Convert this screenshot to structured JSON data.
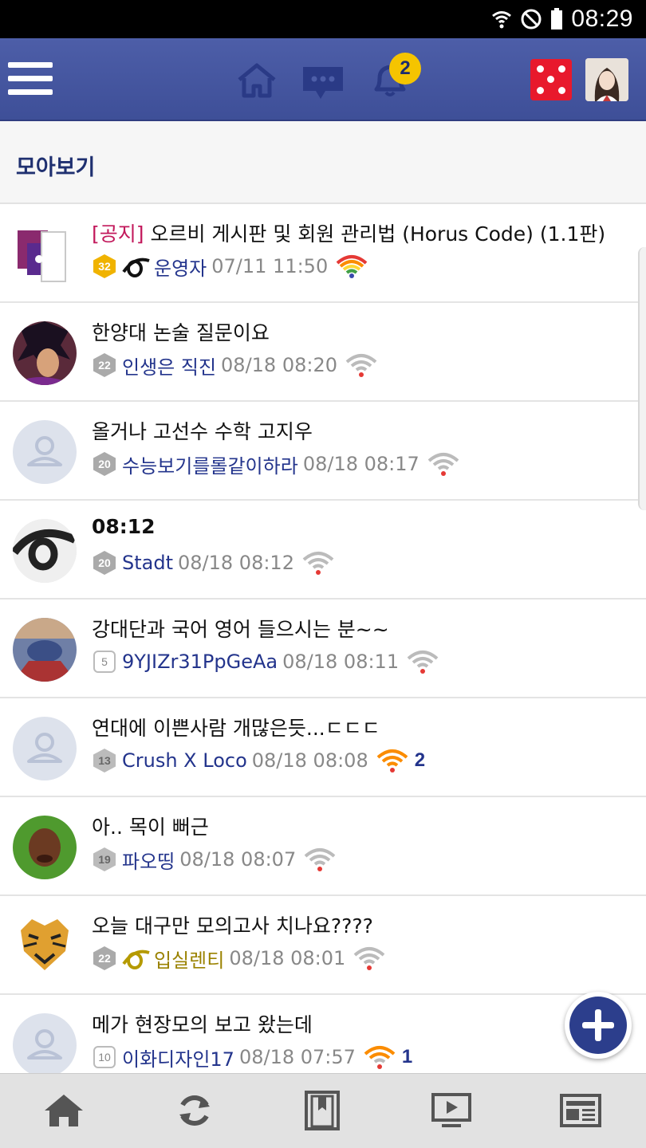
{
  "status_bar": {
    "time": "08:29"
  },
  "top_bar": {
    "icons": [
      "menu-icon",
      "home-icon",
      "chat-icon",
      "bell-icon",
      "dice-icon",
      "profile-avatar"
    ],
    "notification_badge": "2",
    "accent": "#4d5ea8"
  },
  "section": {
    "title": "모아보기"
  },
  "posts": [
    {
      "tag": "[공지]",
      "title": "오르비 게시판 및 회원 관리법 (Horus Code) (1.1판)",
      "level": "32",
      "author": "운영자",
      "time": "07/11 11:50",
      "count": ""
    },
    {
      "tag": "",
      "title": "한양대 논술 질문이요",
      "level": "22",
      "author": "인생은 직진",
      "time": "08/18 08:20",
      "count": ""
    },
    {
      "tag": "",
      "title": "올거나 고선수 수학 고지우",
      "level": "20",
      "author": "수능보기를롤같이하라",
      "time": "08/18 08:17",
      "count": ""
    },
    {
      "tag": "",
      "title": "08:12",
      "level": "20",
      "author": "Stadt",
      "time": "08/18 08:12",
      "count": ""
    },
    {
      "tag": "",
      "title": "강대단과 국어 영어 들으시는 분~~",
      "level": "5",
      "author": "9YJIZr31PpGeAa",
      "time": "08/18 08:11",
      "count": ""
    },
    {
      "tag": "",
      "title": "연대에 이쁜사람 개많은듯...ㄷㄷㄷ",
      "level": "13",
      "author": "Crush X Loco",
      "time": "08/18 08:08",
      "count": "2"
    },
    {
      "tag": "",
      "title": "아.. 목이 뻐근",
      "level": "19",
      "author": "파오띵",
      "time": "08/18 08:07",
      "count": ""
    },
    {
      "tag": "",
      "title": "오늘 대구만 모의고사 치나요????",
      "level": "22",
      "author": "입실렌티",
      "time": "08/18 08:01",
      "count": ""
    },
    {
      "tag": "",
      "title": "메가 현장모의 보고 왔는데",
      "level": "10",
      "author": "이화디자인17",
      "time": "08/18 07:57",
      "count": "1"
    }
  ],
  "bottom_nav": [
    "home-icon",
    "refresh-icon",
    "bookmark-icon",
    "video-icon",
    "news-icon"
  ]
}
